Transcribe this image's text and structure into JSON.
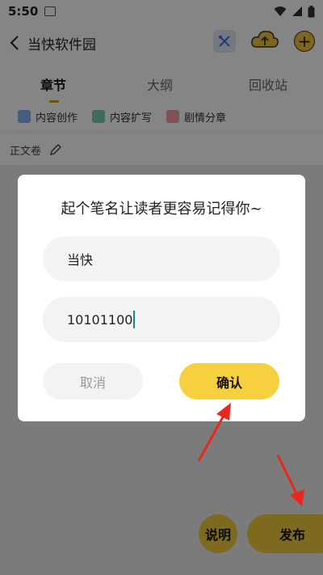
{
  "status_bar": {
    "time": "5:50"
  },
  "header": {
    "title": "当快软件园"
  },
  "tabs": [
    {
      "label": "章节",
      "active": true
    },
    {
      "label": "大纲",
      "active": false
    },
    {
      "label": "回收站",
      "active": false
    }
  ],
  "chips": [
    {
      "label": "内容创作",
      "icon": "content-create-icon",
      "color": "#8ab0f0"
    },
    {
      "label": "内容扩写",
      "icon": "content-expand-icon",
      "color": "#7ccdb0"
    },
    {
      "label": "剧情分章",
      "icon": "plot-split-icon",
      "color": "#f0a0a0"
    }
  ],
  "section": {
    "label": "正文卷"
  },
  "fab": {
    "help_label": "说明",
    "publish_label": "发布"
  },
  "dialog": {
    "title": "起个笔名让读者更容易记得你~",
    "pen_name_value": "当快",
    "id_value": "10101100",
    "cancel_label": "取消",
    "confirm_label": "确认"
  },
  "colors": {
    "accent": "#f7d03f",
    "annotation": "#e8281c"
  }
}
